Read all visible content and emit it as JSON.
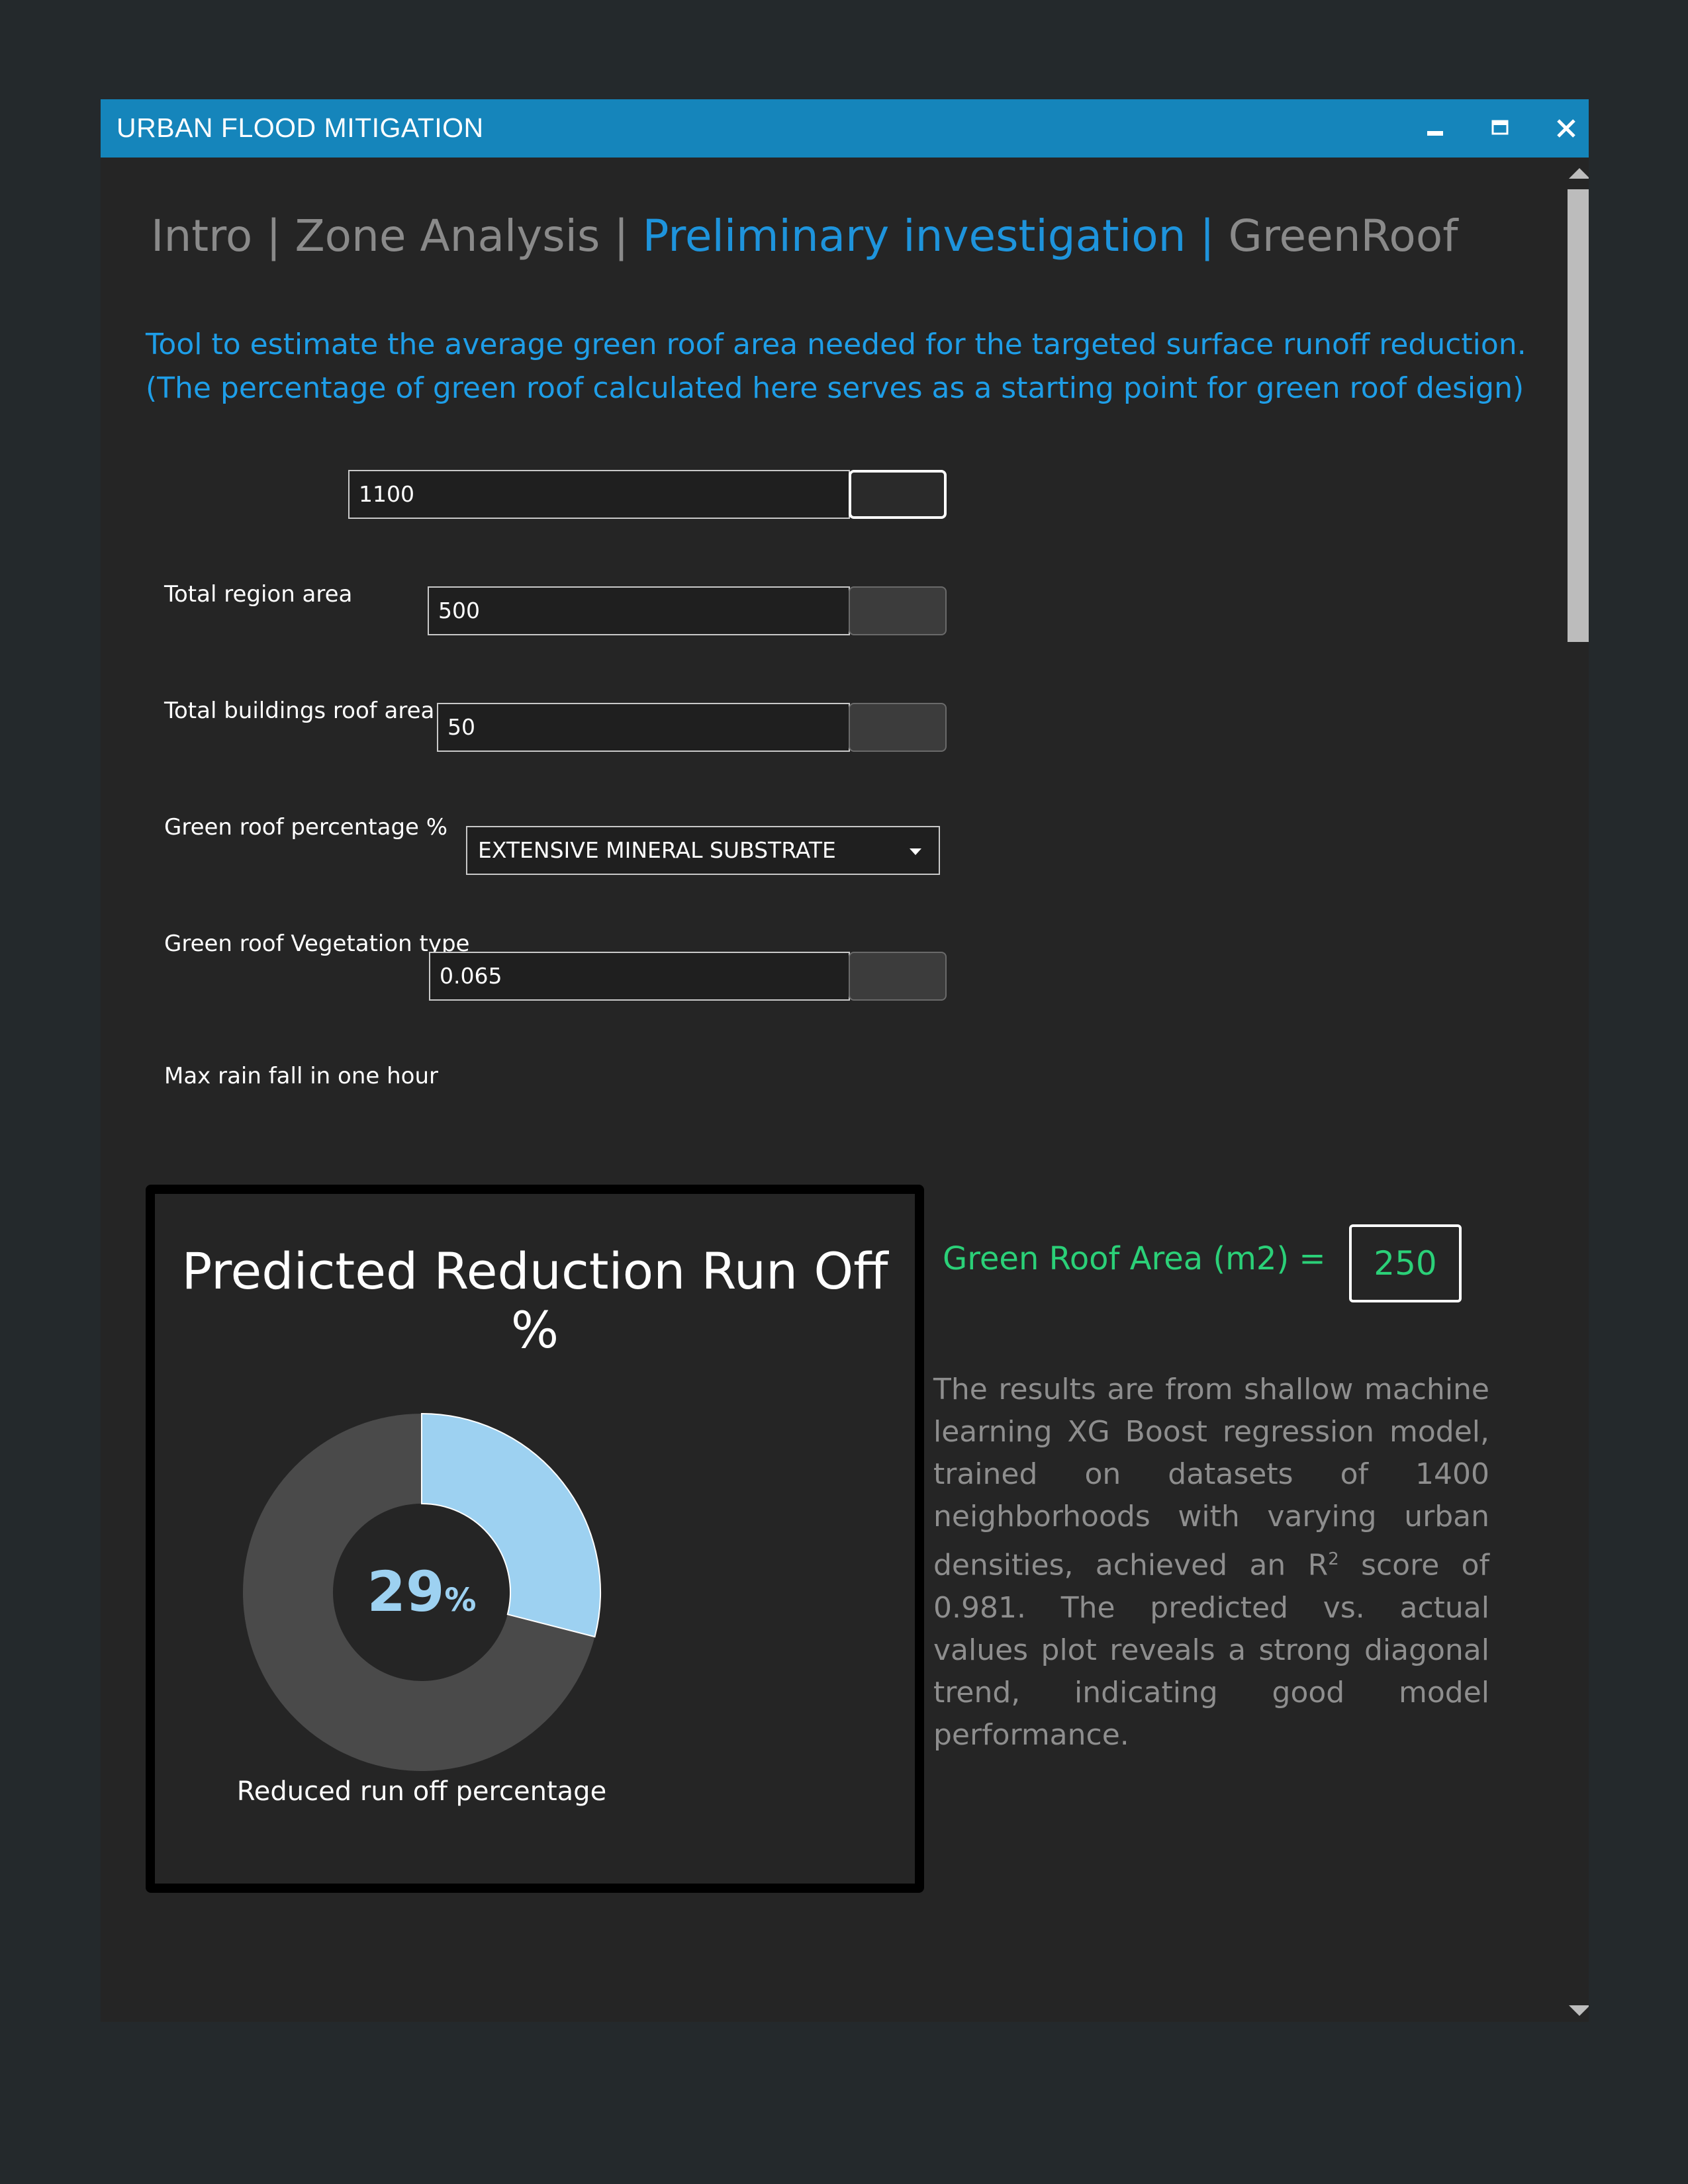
{
  "window": {
    "title": "URBAN FLOOD MITIGATION",
    "controls": [
      "minimize-icon",
      "maximize-icon",
      "close-icon"
    ]
  },
  "tabs": [
    {
      "label": "Intro",
      "separator": " | ",
      "active": false
    },
    {
      "label": "Zone Analysis",
      "separator": " | ",
      "active": false
    },
    {
      "label": "Preliminary investigation",
      "separator": " | ",
      "active": true
    },
    {
      "label": "GreenRoof",
      "separator": "",
      "active": false
    }
  ],
  "intro": {
    "line1": "Tool to estimate the average green roof area needed for the targeted surface runoff reduction.",
    "line2": "(The percentage of green roof calculated here serves as a starting point for green roof design)"
  },
  "fields": {
    "region_area": {
      "label": "Total region area",
      "value": "1100"
    },
    "roof_area": {
      "label": "Total buildings roof area",
      "value": "500"
    },
    "green_pct": {
      "label": "Green roof percentage %",
      "value": "50"
    },
    "vegetation": {
      "label": "Green roof Vegetation type",
      "value": "EXTENSIVE MINERAL SUBSTRATE"
    },
    "rainfall": {
      "label": "Max rain fall in one hour",
      "value": "0.065"
    }
  },
  "chart_data": {
    "type": "pie",
    "title": "Predicted Reduction Run Off %",
    "value": 29,
    "value_text": "29",
    "unit": "%",
    "caption": "Reduced run off percentage",
    "colors": {
      "filled": "#9dd1f1",
      "remaining": "#4a4a4a",
      "center_text": "#9dd1f1"
    }
  },
  "result": {
    "label": "Green Roof Area (m2) =",
    "value": "250"
  },
  "description": {
    "before": "The results are from shallow machine learning XG Boost regression model, trained on datasets of 1400 neighborhoods with varying urban densities, achieved an R",
    "sup": "2",
    "after": " score of 0.981. The predicted vs. actual values plot reveals a strong diagonal trend, indicating good model performance."
  },
  "colors": {
    "titlebar": "#1585bb",
    "accent_blue": "#1e94dc",
    "accent_green": "#2bd078",
    "background": "#252525"
  }
}
